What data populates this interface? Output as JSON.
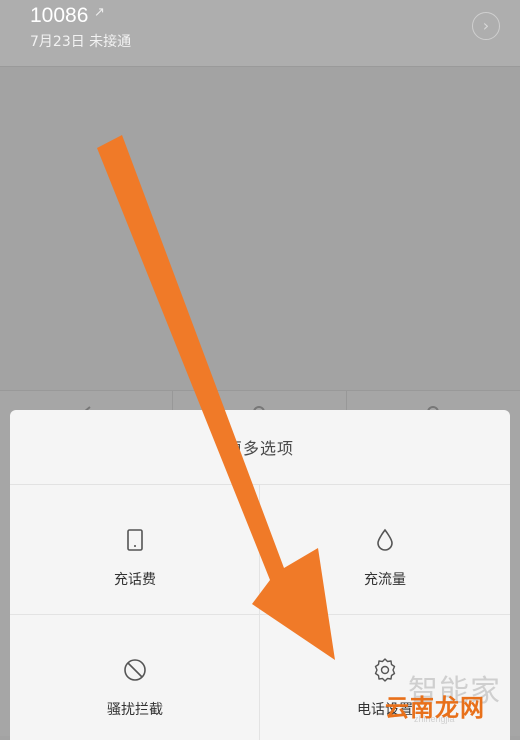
{
  "call": {
    "number": "10086",
    "meta": "7月23日 未接通",
    "arrow_icon": "outgoing-arrow-icon",
    "detail_icon": "chevron-right-icon"
  },
  "sheet": {
    "title": "更多选项",
    "options": [
      {
        "label": "充话费",
        "icon": "phone-device-icon"
      },
      {
        "label": "充流量",
        "icon": "droplet-icon"
      },
      {
        "label": "骚扰拦截",
        "icon": "block-icon"
      },
      {
        "label": "电话设置",
        "icon": "gear-icon"
      }
    ]
  },
  "watermark": {
    "pale_text": "智能家",
    "pale_sub": "zhinengjia",
    "main_text": "云南龙网"
  },
  "colors": {
    "arrow": "#f07a28",
    "sheet_bg": "#f5f5f5",
    "overlay_bg": "#a3a3a3"
  }
}
